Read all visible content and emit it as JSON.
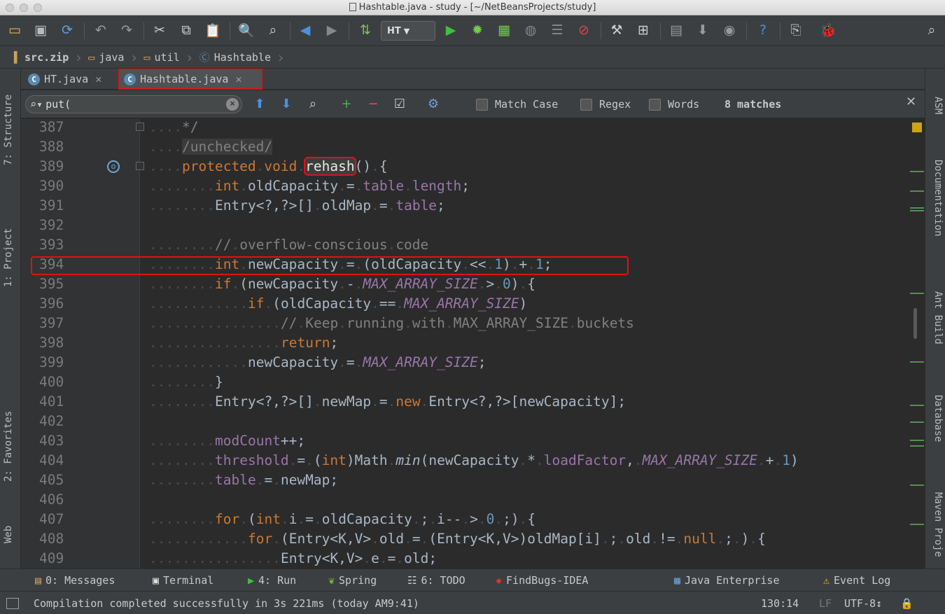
{
  "window": {
    "title": "Hashtable.java - study - [~/NetBeansProjects/study]"
  },
  "toolbar": {
    "run_config": "HT"
  },
  "breadcrumb": [
    "src.zip",
    "java",
    "util",
    "Hashtable"
  ],
  "tabs": [
    {
      "label": "HT.java",
      "active": false
    },
    {
      "label": "Hashtable.java",
      "active": true
    }
  ],
  "left_tools": [
    "7: Structure",
    "1: Project",
    "2: Favorites",
    "Web"
  ],
  "right_tools": [
    "ASM",
    "Documentation",
    "Ant Build",
    "Database",
    "Maven Proje"
  ],
  "find": {
    "query": "put(",
    "match_case_label": "Match Case",
    "regex_label": "Regex",
    "words_label": "Words",
    "matches": "8 matches"
  },
  "code_lines": [
    {
      "n": "387",
      "text": "....*/"
    },
    {
      "n": "388",
      "text": "..../unchecked/"
    },
    {
      "n": "389",
      "text": "....protected.void.rehash().{"
    },
    {
      "n": "390",
      "text": "........int.oldCapacity.=.table.length;"
    },
    {
      "n": "391",
      "text": "........Entry<?,?>[].oldMap.=.table;"
    },
    {
      "n": "392",
      "text": ""
    },
    {
      "n": "393",
      "text": "........//.overflow-conscious.code"
    },
    {
      "n": "394",
      "text": "........int.newCapacity.=.(oldCapacity.<<.1).+.1;"
    },
    {
      "n": "395",
      "text": "........if.(newCapacity.-.MAX_ARRAY_SIZE.>.0).{"
    },
    {
      "n": "396",
      "text": "............if.(oldCapacity.==.MAX_ARRAY_SIZE)"
    },
    {
      "n": "397",
      "text": "................//.Keep.running.with.MAX_ARRAY_SIZE.buckets"
    },
    {
      "n": "398",
      "text": "................return;"
    },
    {
      "n": "399",
      "text": "............newCapacity.=.MAX_ARRAY_SIZE;"
    },
    {
      "n": "400",
      "text": "........}"
    },
    {
      "n": "401",
      "text": "........Entry<?,?>[].newMap.=.new.Entry<?,?>[newCapacity];"
    },
    {
      "n": "402",
      "text": ""
    },
    {
      "n": "403",
      "text": "........modCount++;"
    },
    {
      "n": "404",
      "text": "........threshold.=.(int)Math.min(newCapacity.*.loadFactor,.MAX_ARRAY_SIZE.+.1)"
    },
    {
      "n": "405",
      "text": "........table.=.newMap;"
    },
    {
      "n": "406",
      "text": ""
    },
    {
      "n": "407",
      "text": "........for.(int.i.=.oldCapacity.;.i--.>.0.;).{"
    },
    {
      "n": "408",
      "text": "............for.(Entry<K,V>.old.=.(Entry<K,V>)oldMap[i].;.old.!=.null.;.).{"
    },
    {
      "n": "409",
      "text": "................Entry<K,V>.e.=.old;"
    }
  ],
  "bottom_tools": [
    "0: Messages",
    "Terminal",
    "4: Run",
    "Spring",
    "6: TODO",
    "FindBugs-IDEA",
    "Java Enterprise",
    "Event Log"
  ],
  "status": {
    "message": "Compilation completed successfully in 3s 221ms (today AM9:41)",
    "position": "130:14",
    "line_ending": "LF",
    "encoding": "UTF-8↕"
  },
  "colors": {
    "highlight": "#e0101a",
    "keyword": "#cc7832",
    "field": "#9876aa",
    "number": "#6897bb",
    "comment": "#808080"
  }
}
